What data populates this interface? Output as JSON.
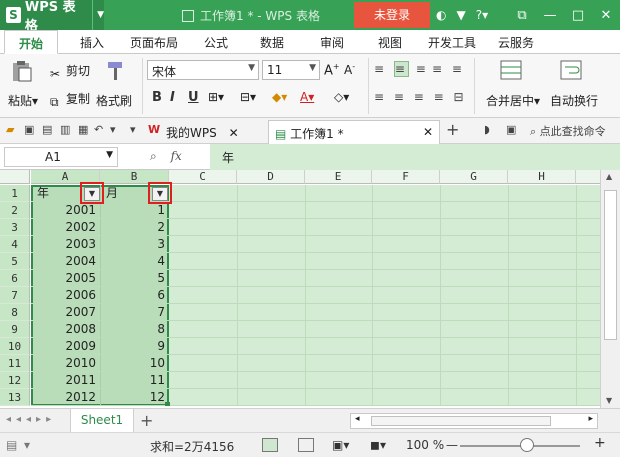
{
  "titlebar": {
    "app_name": "WPS 表格",
    "doc_title": "工作簿1 * - WPS 表格",
    "login_label": "未登录",
    "icons": [
      "shirt-icon",
      "help-icon",
      "restore-icon",
      "minimize-icon",
      "maximize-icon",
      "close-icon"
    ],
    "help_label": "?",
    "min_label": "—",
    "max_label": "□",
    "close_label": "✕"
  },
  "tabs": [
    "开始",
    "插入",
    "页面布局",
    "公式",
    "数据",
    "审阅",
    "视图",
    "开发工具",
    "云服务"
  ],
  "ribbon": {
    "paste_label": "粘贴",
    "cut_label": "剪切",
    "copy_label": "复制",
    "format_painter_label": "格式刷",
    "font_name": "宋体",
    "font_size": "11",
    "bold": "B",
    "italic": "I",
    "underline": "U",
    "merge_label": "合并居中",
    "wrap_label": "自动换行"
  },
  "qbar": {
    "mywps_tab": "我的WPS",
    "doc_tab": "工作簿1 *",
    "search_label": "点此查找命令"
  },
  "formula": {
    "cell_ref": "A1",
    "fx": "fx",
    "content": "年"
  },
  "columns": [
    "A",
    "B",
    "C",
    "D",
    "E",
    "F",
    "G",
    "H"
  ],
  "rows": [
    "1",
    "2",
    "3",
    "4",
    "5",
    "6",
    "7",
    "8",
    "9",
    "10",
    "11",
    "12",
    "13"
  ],
  "headers": {
    "a1": "年",
    "b1": "月"
  },
  "data_years": [
    "2001",
    "2002",
    "2003",
    "2004",
    "2005",
    "2006",
    "2007",
    "2008",
    "2009",
    "2010",
    "2011",
    "2012"
  ],
  "data_months": [
    "1",
    "2",
    "3",
    "4",
    "5",
    "6",
    "7",
    "8",
    "9",
    "10",
    "11",
    "12"
  ],
  "sheet": {
    "name": "Sheet1",
    "add": "+"
  },
  "status": {
    "sum_label": "求和=2万4156",
    "zoom": "100 %",
    "zoom_minus": "—",
    "zoom_plus": "+"
  },
  "colors": {
    "brand": "#37a156",
    "selection": "#b9ddb9",
    "highlight_box": "#e02020"
  }
}
